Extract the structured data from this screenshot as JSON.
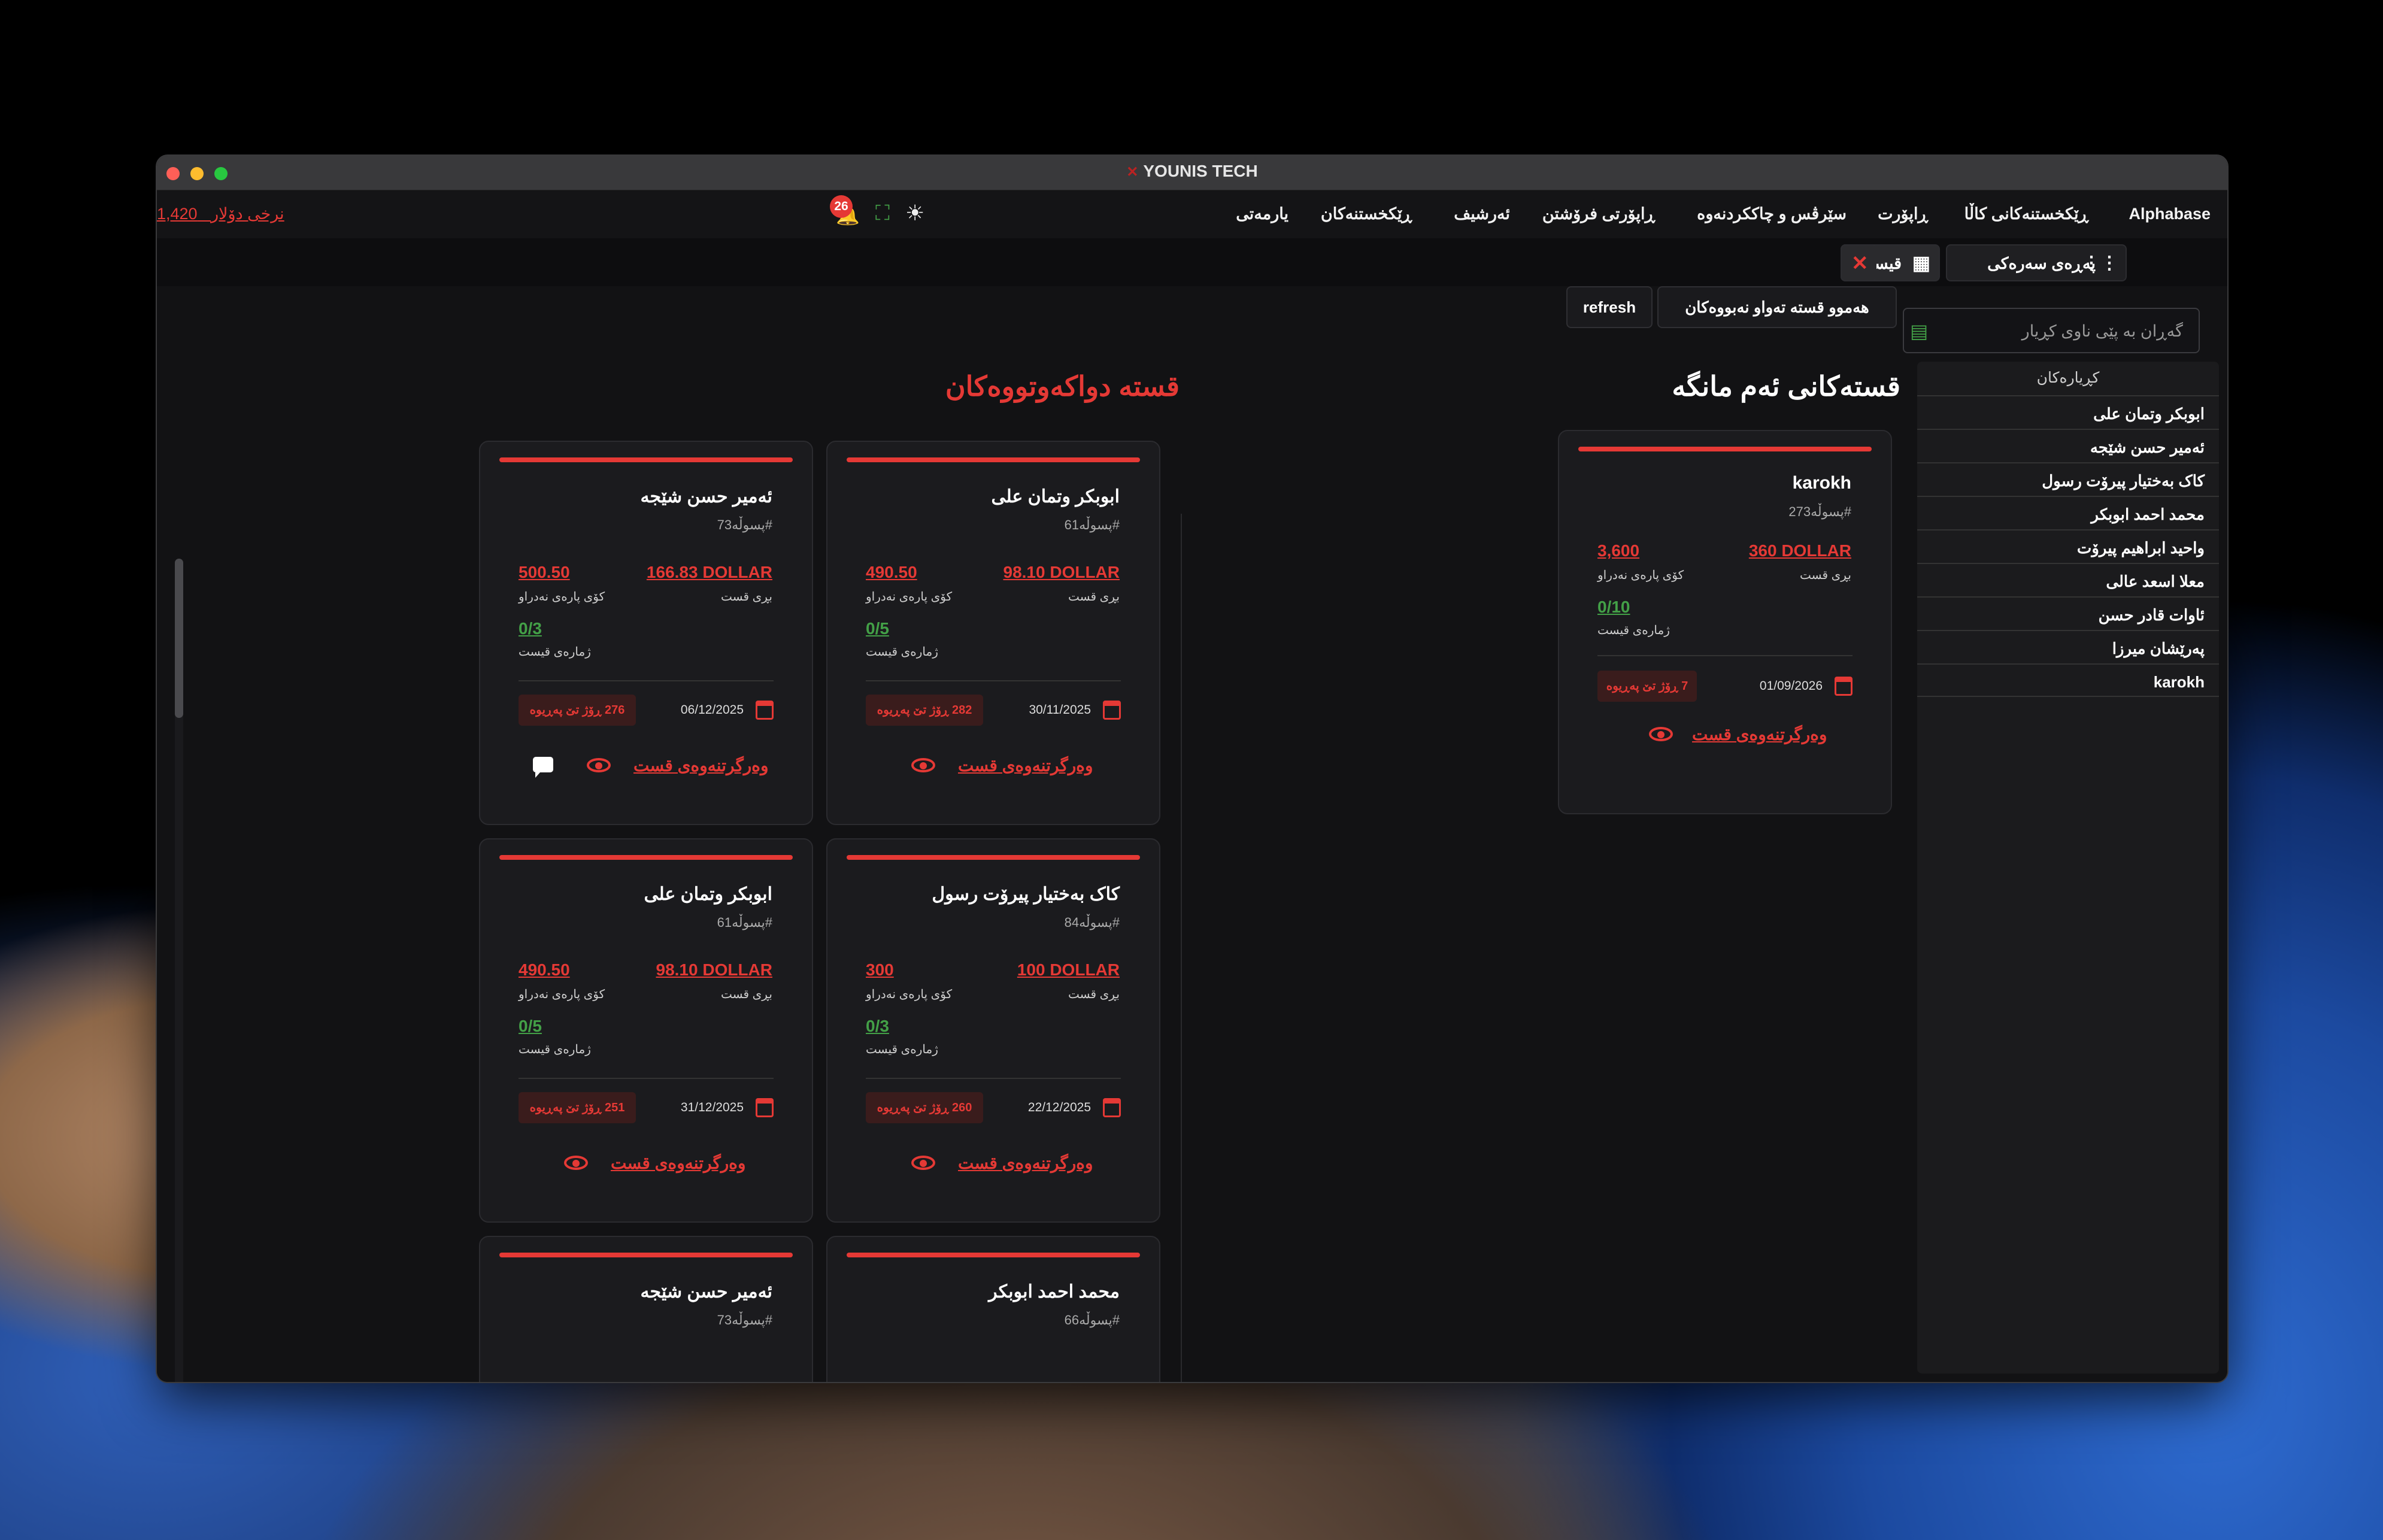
{
  "window": {
    "title": "YOUNIS TECH"
  },
  "menu": {
    "items": [
      "Alphabase",
      "ڕێکخستنەکانی کاڵا",
      "ڕاپۆرت",
      "سێرڤس و چاککردنەوە",
      "ڕاپۆرتی فرۆشتن",
      "ئەرشیف",
      "ڕێکخستنەکان",
      "یارمەتی"
    ],
    "rate_label": "نرخی دۆلار",
    "rate_value": "1,420",
    "notif_count": "26"
  },
  "tabs": {
    "home": "پەڕەی سەرەکی",
    "qist": "قیست"
  },
  "toolbar": {
    "search_placeholder": "گەڕان بە پێی ناوی کڕیار",
    "all_unpaid": "هەموو قستە تەواو نەبووەکان",
    "refresh": "refresh"
  },
  "sidebar": {
    "header": "کڕیارەکان",
    "customers": [
      "ابوبکر وتمان علی",
      "ئەمیر حسن شێجە",
      "کاک بەختیار پیرۆت رسول",
      "محمد احمد ابوبکر",
      "واحید ابراهیم پیرۆت",
      "معلا اسعد عالی",
      "ئاوات قادر حسن",
      "پەرێشان میرزا",
      "karokh"
    ]
  },
  "sections": {
    "this_month": "قستەکانی ئەم مانگە",
    "overdue": "قستە دواکەوتووەکان"
  },
  "labels": {
    "amount": "بڕی قست",
    "remaining": "کۆی پارەی نەدراو",
    "count": "ژمارەی قیست",
    "receive": "وەرگرتنەوەی قست"
  },
  "month_cards": [
    {
      "name": "karokh",
      "invoice": "#پسوڵە273",
      "amount": "360 DOLLAR",
      "remaining": "3,600",
      "count": "0/10",
      "date": "01/09/2026",
      "days": "7 ڕۆژ تێ پەڕیوە"
    }
  ],
  "overdue_cards": [
    {
      "name": "ابوبکر وتمان علی",
      "invoice": "#پسوڵە61",
      "amount": "98.10 DOLLAR",
      "remaining": "490.50",
      "count": "0/5",
      "date": "30/11/2025",
      "days": "282 ڕۆژ تێ پەڕیوە"
    },
    {
      "name": "ئەمیر حسن شێجە",
      "invoice": "#پسوڵە73",
      "amount": "166.83 DOLLAR",
      "remaining": "500.50",
      "count": "0/3",
      "date": "06/12/2025",
      "days": "276 ڕۆژ تێ پەڕیوە"
    },
    {
      "name": "کاک بەختیار پیرۆت رسول",
      "invoice": "#پسوڵە84",
      "amount": "100 DOLLAR",
      "remaining": "300",
      "count": "0/3",
      "date": "22/12/2025",
      "days": "260 ڕۆژ تێ پەڕیوە"
    },
    {
      "name": "ابوبکر وتمان علی",
      "invoice": "#پسوڵە61",
      "amount": "98.10 DOLLAR",
      "remaining": "490.50",
      "count": "0/5",
      "date": "31/12/2025",
      "days": "251 ڕۆژ تێ پەڕیوە"
    },
    {
      "name": "محمد احمد ابوبکر",
      "invoice": "#پسوڵە66"
    },
    {
      "name": "ئەمیر حسن شێجە",
      "invoice": "#پسوڵە73"
    }
  ],
  "colors": {
    "accent": "#e53935",
    "success": "#43a047",
    "window_bg": "#121214",
    "card_bg": "#1b1b1e"
  }
}
